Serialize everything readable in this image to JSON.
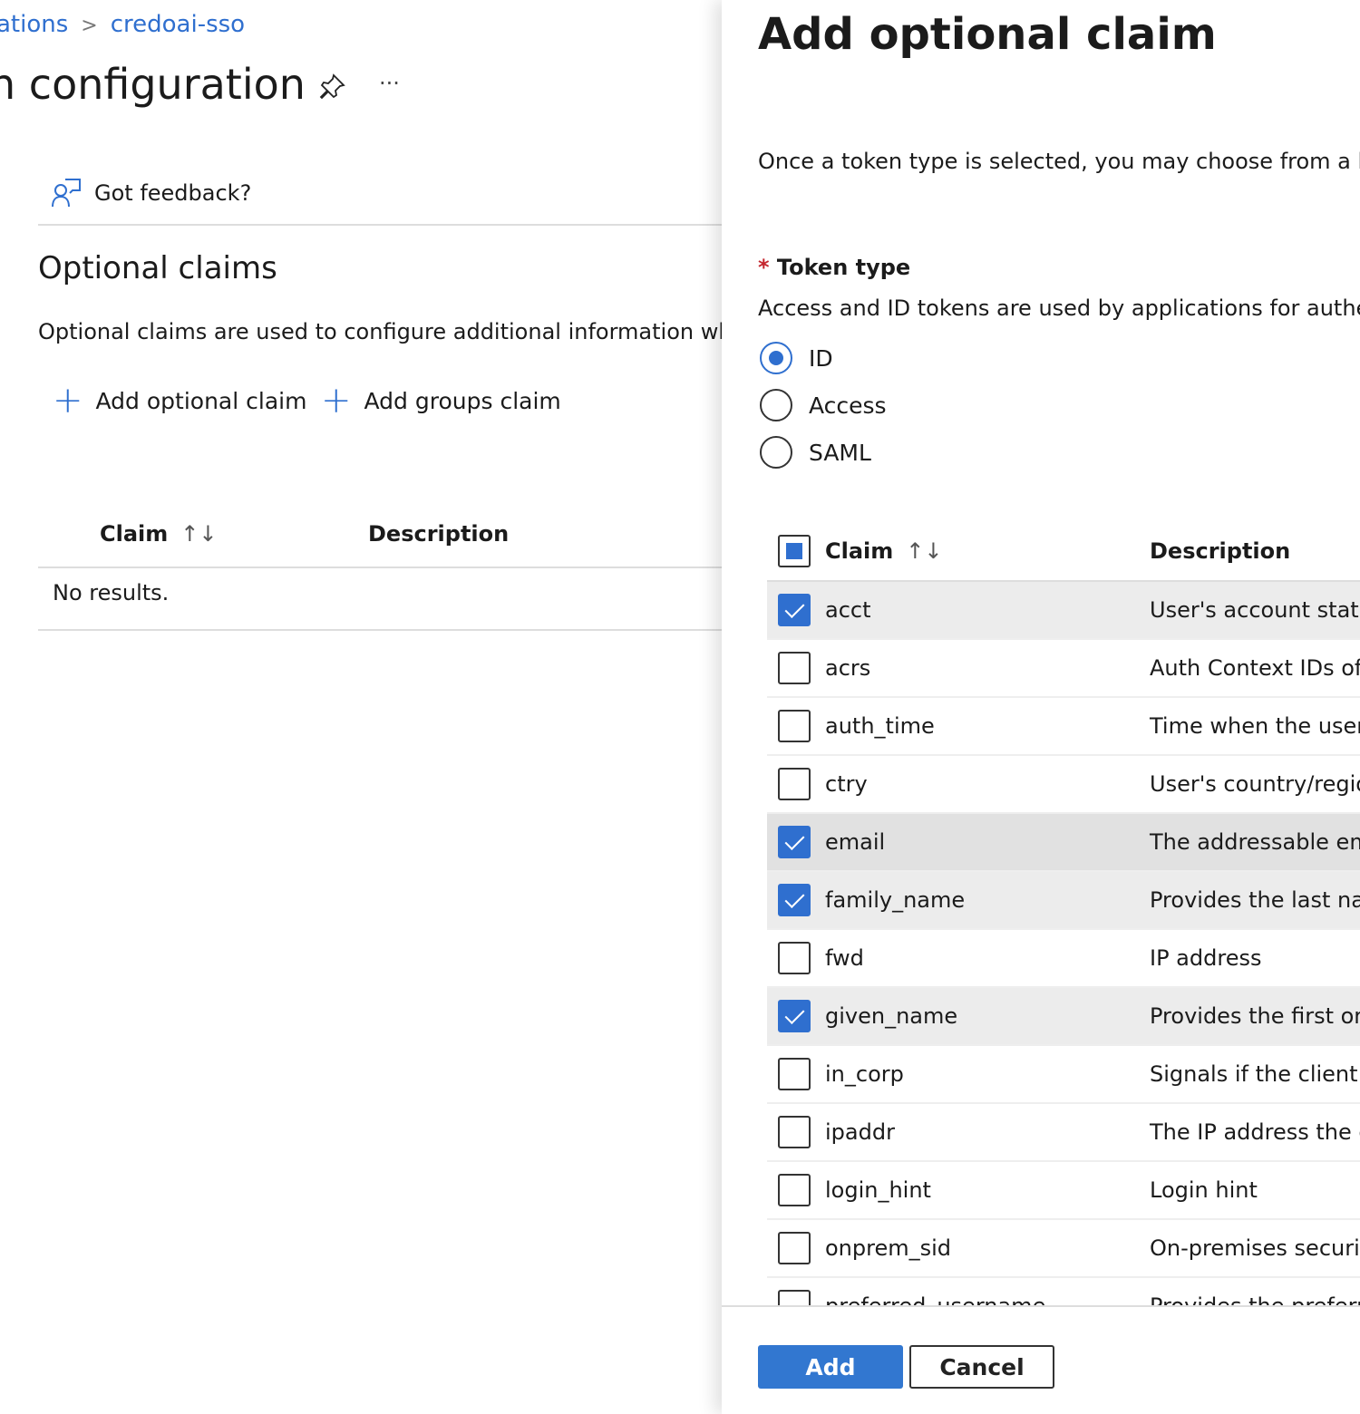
{
  "breadcrumb": {
    "items": [
      "ations",
      "credoai-sso"
    ]
  },
  "page": {
    "title": "n configuration",
    "pin_icon": "pin-icon",
    "more_label": "···",
    "feedback": "Got feedback?",
    "section_title": "Optional claims",
    "section_desc": "Optional claims are used to configure additional information whic",
    "commands": [
      "Add optional claim",
      "Add groups claim"
    ],
    "table": {
      "headers": [
        "Claim",
        "Description"
      ],
      "sort_glyph": "↑↓",
      "empty": "No results."
    }
  },
  "panel": {
    "title": "Add optional claim",
    "intro": "Once a token type is selected, you may choose from a list",
    "token_label": "Token type",
    "required_mark": "*",
    "token_desc": "Access and ID tokens are used by applications for authent",
    "token_types": [
      {
        "label": "ID",
        "selected": true
      },
      {
        "label": "Access",
        "selected": false
      },
      {
        "label": "SAML",
        "selected": false
      }
    ],
    "headers": [
      "Claim",
      "Description"
    ],
    "claims": [
      {
        "name": "acct",
        "desc": "User's account status",
        "checked": true
      },
      {
        "name": "acrs",
        "desc": "Auth Context IDs of",
        "checked": false
      },
      {
        "name": "auth_time",
        "desc": "Time when the user",
        "checked": false
      },
      {
        "name": "ctry",
        "desc": "User's country/region",
        "checked": false
      },
      {
        "name": "email",
        "desc": "The addressable email",
        "checked": true
      },
      {
        "name": "family_name",
        "desc": "Provides the last name",
        "checked": true
      },
      {
        "name": "fwd",
        "desc": "IP address",
        "checked": false
      },
      {
        "name": "given_name",
        "desc": "Provides the first or",
        "checked": true
      },
      {
        "name": "in_corp",
        "desc": "Signals if the client is",
        "checked": false
      },
      {
        "name": "ipaddr",
        "desc": "The IP address the cl",
        "checked": false
      },
      {
        "name": "login_hint",
        "desc": "Login hint",
        "checked": false
      },
      {
        "name": "onprem_sid",
        "desc": "On-premises security",
        "checked": false
      },
      {
        "name": "preferred_username",
        "desc": "Provides the preferred",
        "checked": false
      }
    ],
    "add_label": "Add",
    "cancel_label": "Cancel",
    "accent": "#2f6fcf"
  }
}
